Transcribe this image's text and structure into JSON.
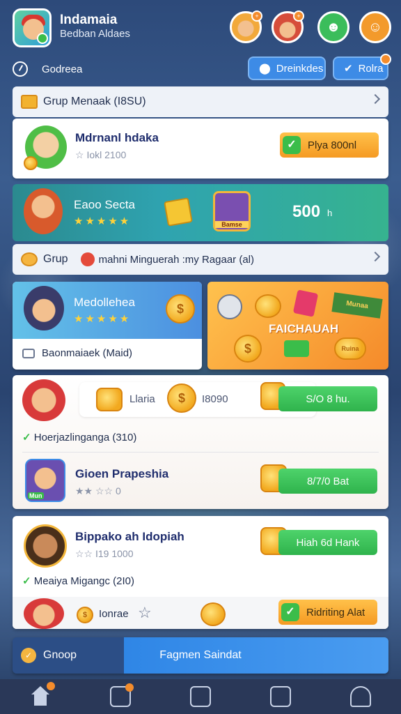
{
  "header": {
    "title": "Indamaia",
    "subtitle": "Bedban Aldaes"
  },
  "status": {
    "text": "Godreea"
  },
  "actions": {
    "primary": "Dreinkdes",
    "secondary": "Rolra"
  },
  "group1": {
    "label": "Grup Menaak (I8SU)"
  },
  "item1": {
    "name": "Mdrnanl hdaka",
    "sub": "☆ Iokl 2100",
    "button": "Plya 800nl"
  },
  "banner": {
    "name": "Eaoo Secta",
    "stars": "★★★★★",
    "value": "500",
    "unit": "h",
    "badge": "Bamse"
  },
  "group2": {
    "label": "Grup",
    "detail": "mahni Minguerah :my Ragaar (al)"
  },
  "tile_left": {
    "name": "Medollehea",
    "stars": "★★★★★",
    "footer": "Baonmaiaek (Maid)"
  },
  "tile_right": {
    "label": "FAICHAUAH",
    "badge": "Munaa",
    "coin": "Ruina"
  },
  "reward1": {
    "label": "Llaria",
    "value": "I8090",
    "button": "S/O 8 hu."
  },
  "section1": {
    "label": "Hoerjazlinganga (310)"
  },
  "item2": {
    "name": "Gioen Prapeshia",
    "sub": "★★ ☆☆ 0",
    "button": "8/7/0 Bat",
    "badge": "Mun"
  },
  "item3": {
    "name": "Bippako ah Idopiah",
    "sub": "☆☆ I19 1000",
    "button": "Hiah 6d Hank"
  },
  "section2": {
    "label": "Meaiya Migangc (2I0)"
  },
  "reward2": {
    "label": "Ionrae",
    "button": "Ridriting Alat"
  },
  "footer_bar": {
    "left": "Gnoop",
    "center": "Fagmen Saindat"
  },
  "colors": {
    "accent": "#3d8be6",
    "green": "#2fb34c",
    "orange": "#f59a23"
  }
}
